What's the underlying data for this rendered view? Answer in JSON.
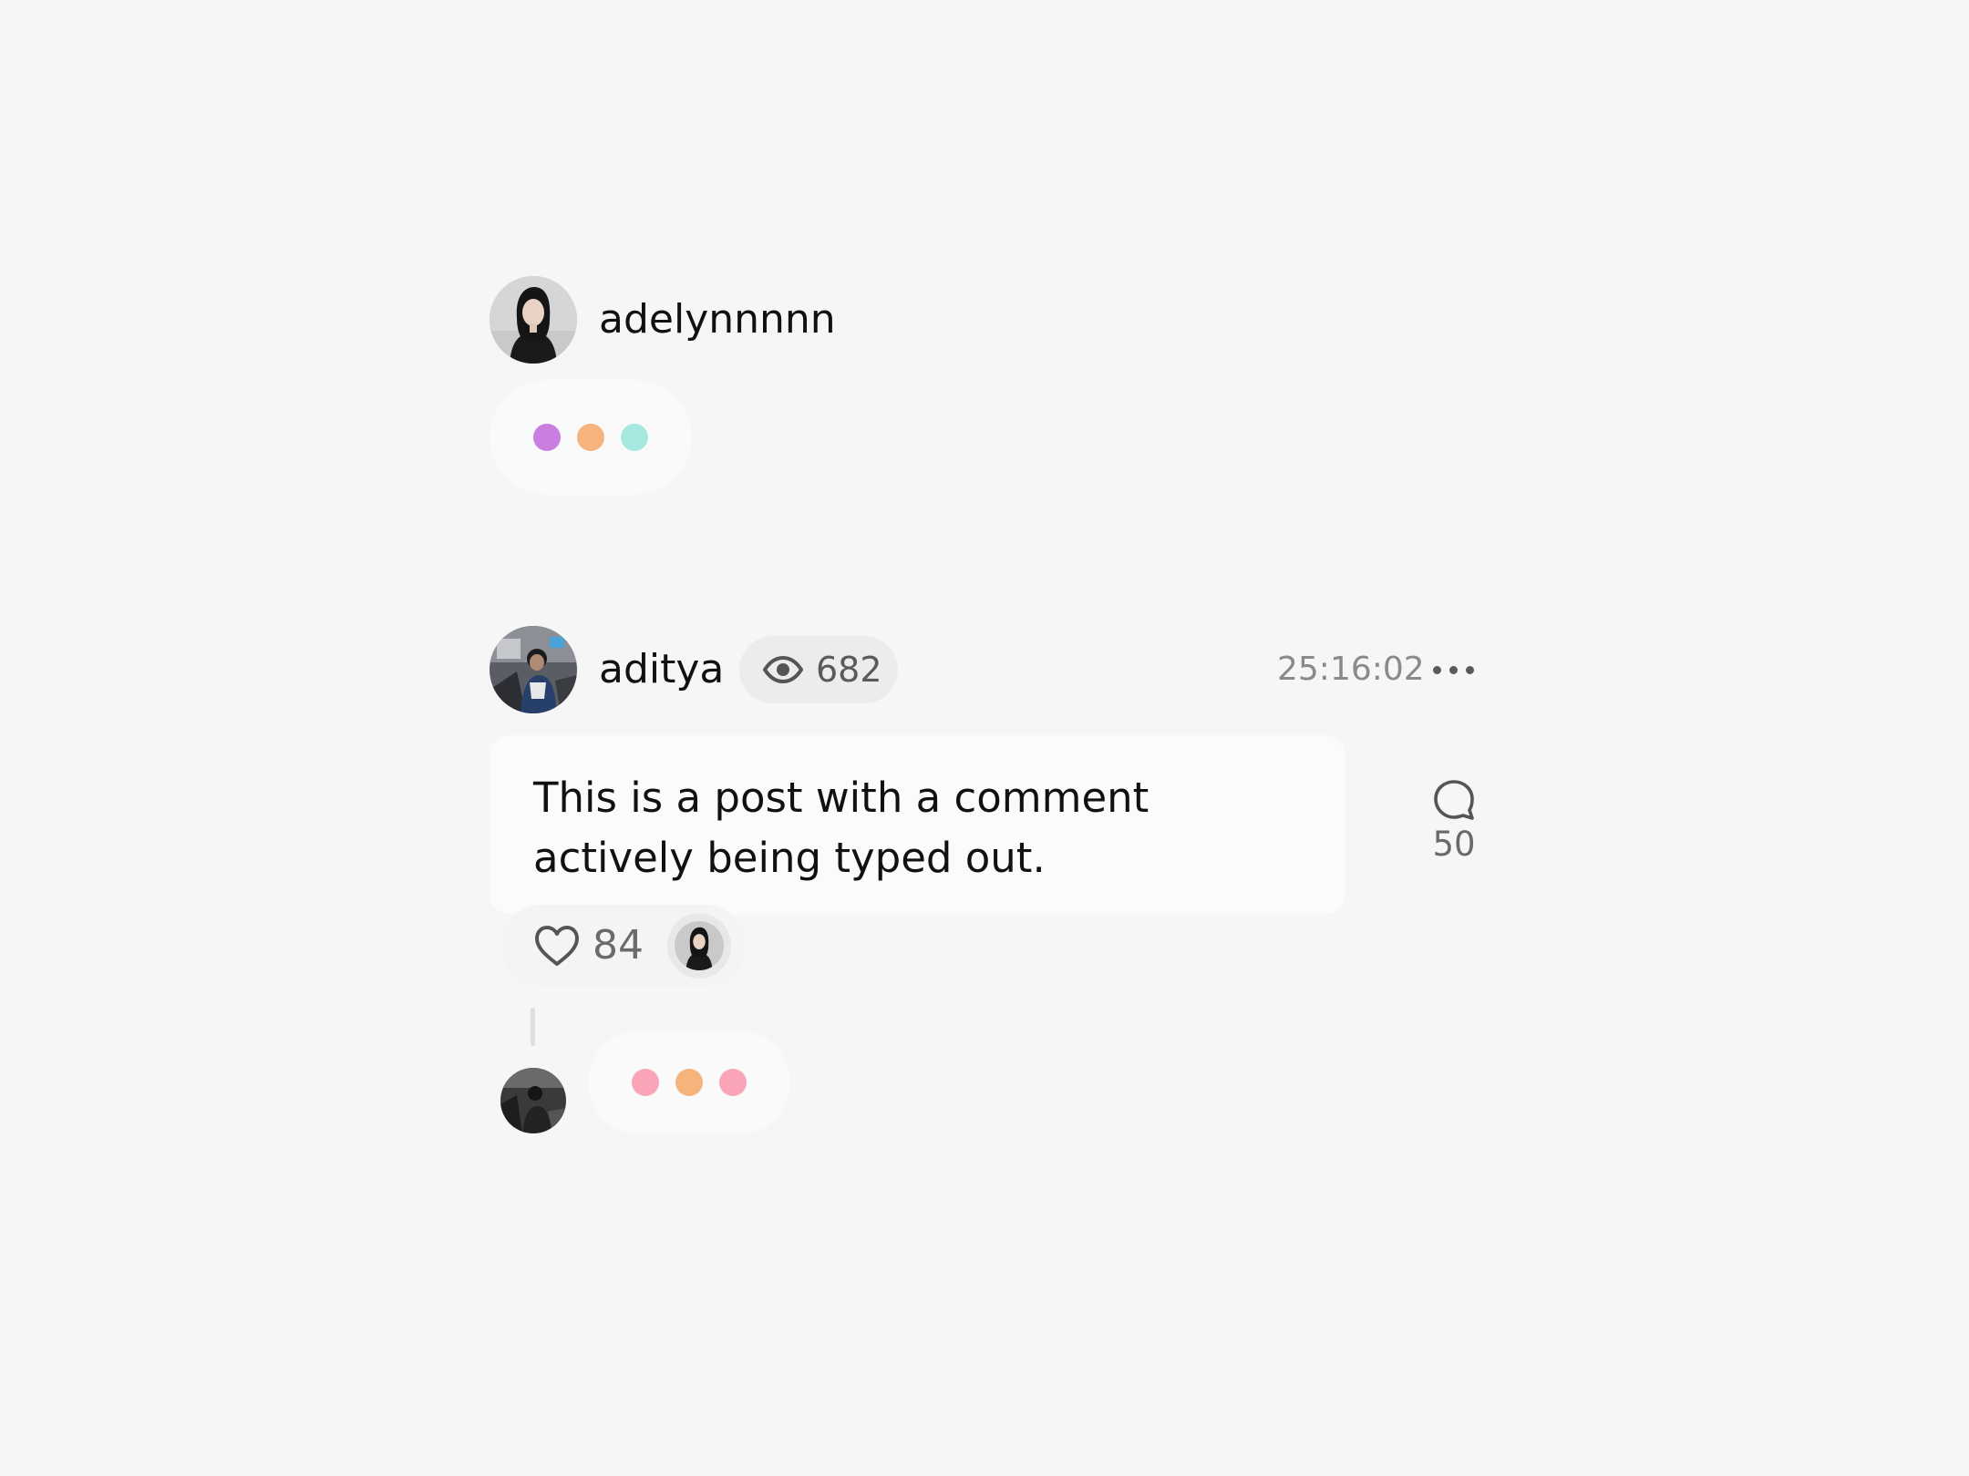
{
  "typing_post": {
    "username": "adelynnnnn",
    "avatar": "avatar-adelynnnnn",
    "typing_dots": [
      "#c97ee0",
      "#f7b37c",
      "#a7e8e0"
    ]
  },
  "post": {
    "username": "aditya",
    "avatar": "avatar-aditya",
    "views": "682",
    "view_icon": "eye-icon",
    "timestamp": "25:16:02",
    "more_icon": "more-horizontal-icon",
    "text": "This is a post with a comment actively being typed out.",
    "comments_count": "50",
    "comment_icon": "comment-bubble-icon",
    "likes_count": "84",
    "like_icon": "heart-icon",
    "liked_by_avatar": "avatar-adelynnnnn"
  },
  "reply_typing": {
    "avatar": "avatar-commenter",
    "typing_dots": [
      "#f9a5b7",
      "#f7b37c",
      "#f9a5b7"
    ]
  }
}
